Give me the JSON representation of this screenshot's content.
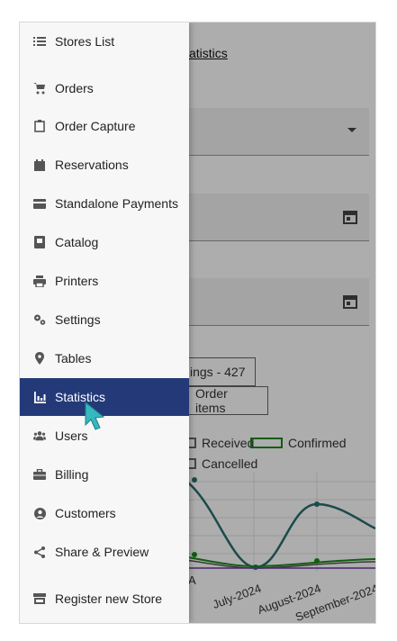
{
  "drawer": {
    "items": [
      {
        "label": "Stores List",
        "icon": "list-icon"
      },
      {
        "label": "Orders",
        "icon": "cart-icon"
      },
      {
        "label": "Order Capture",
        "icon": "clipboard-icon"
      },
      {
        "label": "Reservations",
        "icon": "calendar-icon"
      },
      {
        "label": "Standalone Payments",
        "icon": "credit-card-icon"
      },
      {
        "label": "Catalog",
        "icon": "book-icon"
      },
      {
        "label": "Printers",
        "icon": "printer-icon"
      },
      {
        "label": "Settings",
        "icon": "gears-icon"
      },
      {
        "label": "Tables",
        "icon": "map-pin-icon"
      },
      {
        "label": "Statistics",
        "icon": "bar-chart-icon",
        "active": true
      },
      {
        "label": "Users",
        "icon": "users-icon"
      },
      {
        "label": "Billing",
        "icon": "briefcase-icon"
      },
      {
        "label": "Customers",
        "icon": "user-circle-icon"
      },
      {
        "label": "Share & Preview",
        "icon": "share-icon"
      },
      {
        "label": "Register new Store",
        "icon": "store-icon"
      }
    ]
  },
  "background": {
    "breadcrumb_fragment": "atistics",
    "buttons": [
      "ings - 427",
      "Order items"
    ],
    "legend": [
      {
        "label": "Received",
        "color": "#666666"
      },
      {
        "label": "Confirmed",
        "color": "#1a8a1a"
      },
      {
        "label": "Cancelled",
        "color": "#666666"
      }
    ],
    "chart_x_labels": [
      "A",
      "July-2024",
      "August-2024",
      "September-2024"
    ]
  },
  "colors": {
    "active_bg": "#243a78",
    "accent_line": "#2a6e6e",
    "cursor": "#35b8c0"
  }
}
